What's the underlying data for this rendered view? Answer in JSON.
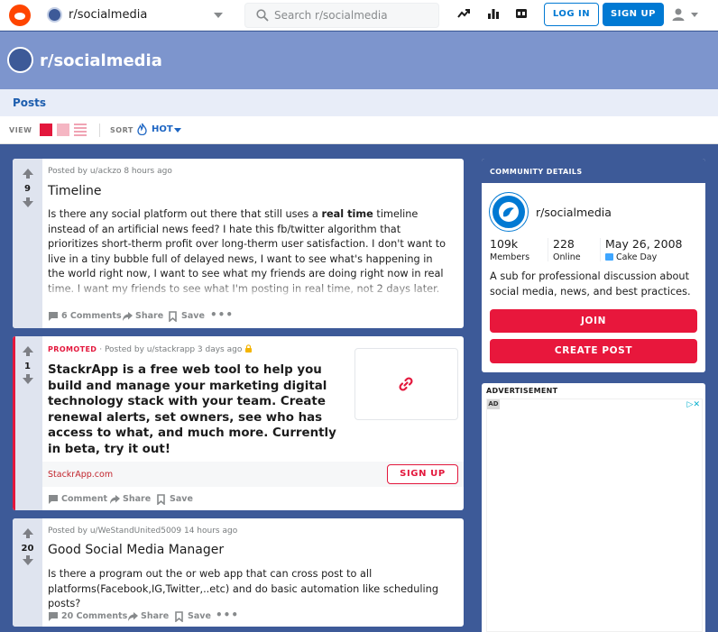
{
  "header": {
    "community": "r/socialmedia",
    "search_placeholder": "Search r/socialmedia",
    "login_label": "LOG IN",
    "signup_label": "SIGN UP"
  },
  "banner": {
    "title": "r/socialmedia"
  },
  "nav": {
    "tab_posts": "Posts"
  },
  "toolbar": {
    "view_label": "VIEW",
    "sort_label": "SORT",
    "sort_value": "HOT"
  },
  "posts": [
    {
      "score": "9",
      "meta": "Posted by u/ackzo 8 hours ago",
      "title": "Timeline",
      "body_before": "Is there any social platform out there that still uses a ",
      "body_bold": "real time",
      "body_after": " timeline instead of an artificial news feed? I hate this fb/twitter algorithm that prioritizes short-therm profit over long-therm user satisfaction. I don't want to live in a tiny bubble full of delayed news, I want to see what's happening in the world right now, I want to see what my friends are doing right now in real time. I want my friends to see what I'm posting in real time, not 2 days later.",
      "comments": "6 Comments",
      "share": "Share",
      "save": "Save",
      "more": "•••"
    },
    {
      "score": "1",
      "promoted_label": "PROMOTED",
      "meta": " · Posted by u/stackrapp 3 days ago",
      "title": "StackrApp is a free web tool to help you build and manage your marketing digital technology stack with your team. Create renewal alerts, set owners, see who has access to what, and much more. Currently in beta, try it out!",
      "domain": "StackrApp.com",
      "cta": "SIGN UP",
      "comments": "Comment",
      "share": "Share",
      "save": "Save"
    },
    {
      "score": "20",
      "meta": "Posted by u/WeStandUnited5009 14 hours ago",
      "title": "Good Social Media Manager",
      "body": "Is there a program out the or web app that can cross post to all platforms(Facebook,IG,Twitter,..etc) and do basic automation like scheduling posts?",
      "comments": "20 Comments",
      "share": "Share",
      "save": "Save",
      "more": "•••"
    }
  ],
  "sidebar": {
    "heading": "COMMUNITY DETAILS",
    "name": "r/socialmedia",
    "members_count": "109k",
    "members_label": "Members",
    "online_count": "228",
    "online_label": "Online",
    "cake_date": "May 26, 2008",
    "cake_label": "Cake Day",
    "description": "A sub for professional discussion about social media, news, and best practices.",
    "join_label": "JOIN",
    "create_label": "CREATE POST",
    "ad_label": "ADVERTISEMENT",
    "ad_tag": "AD"
  },
  "colors": {
    "background": "#3d5a98",
    "banner": "#7d95cd",
    "accent_red": "#e8173c",
    "link_blue": "#0079d3"
  }
}
